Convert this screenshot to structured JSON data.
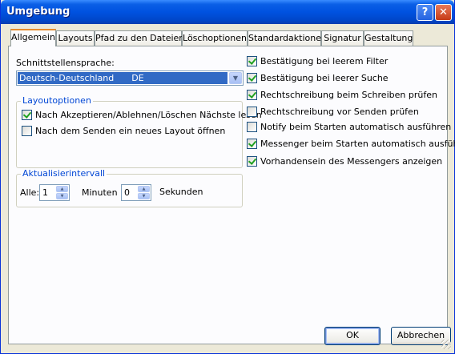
{
  "window": {
    "title": "Umgebung",
    "help_glyph": "?",
    "close_glyph": "✕"
  },
  "tabs": [
    {
      "label": "Allgemein",
      "active": true
    },
    {
      "label": "Layouts"
    },
    {
      "label": "Pfad zu den Dateien"
    },
    {
      "label": "Löschoptionen"
    },
    {
      "label": "Standardaktionen"
    },
    {
      "label": "Signatur"
    },
    {
      "label": "Gestaltung"
    }
  ],
  "language": {
    "label": "Schnittstellensprache:",
    "selected_name": "Deutsch-Deutschland",
    "selected_code": "DE"
  },
  "layout_options": {
    "title": "Layoutoptionen",
    "items": [
      {
        "label": "Nach Akzeptieren/Ablehnen/Löschen Nächste lesen",
        "checked": true
      },
      {
        "label": "Nach dem Senden ein neues Layout öffnen",
        "checked": false
      }
    ]
  },
  "refresh": {
    "title": "Aktualisierintervall",
    "all_label": "Alle:",
    "minutes_value": "1",
    "minutes_label": "Minuten",
    "seconds_value": "0",
    "seconds_label": "Sekunden"
  },
  "options": [
    {
      "label": "Bestätigung bei leerem Filter",
      "checked": true
    },
    {
      "label": "Bestätigung bei leerer Suche",
      "checked": true
    },
    {
      "label": "Rechtschreibung beim Schreiben prüfen",
      "checked": true
    },
    {
      "label": "Rechtschreibung vor Senden prüfen",
      "checked": false
    },
    {
      "label": "Notify beim Starten automatisch ausführen",
      "checked": false
    },
    {
      "label": "Messenger beim Starten automatisch ausführen",
      "checked": true
    },
    {
      "label": "Vorhandensein des Messengers anzeigen",
      "checked": true
    }
  ],
  "buttons": {
    "ok": "OK",
    "cancel": "Abbrechen"
  },
  "colors": {
    "title_bar": "#0052e0",
    "dialog_bg": "#ece9d8",
    "group_title": "#0046d5",
    "selection": "#316ac5",
    "checkmark": "#21a121"
  }
}
